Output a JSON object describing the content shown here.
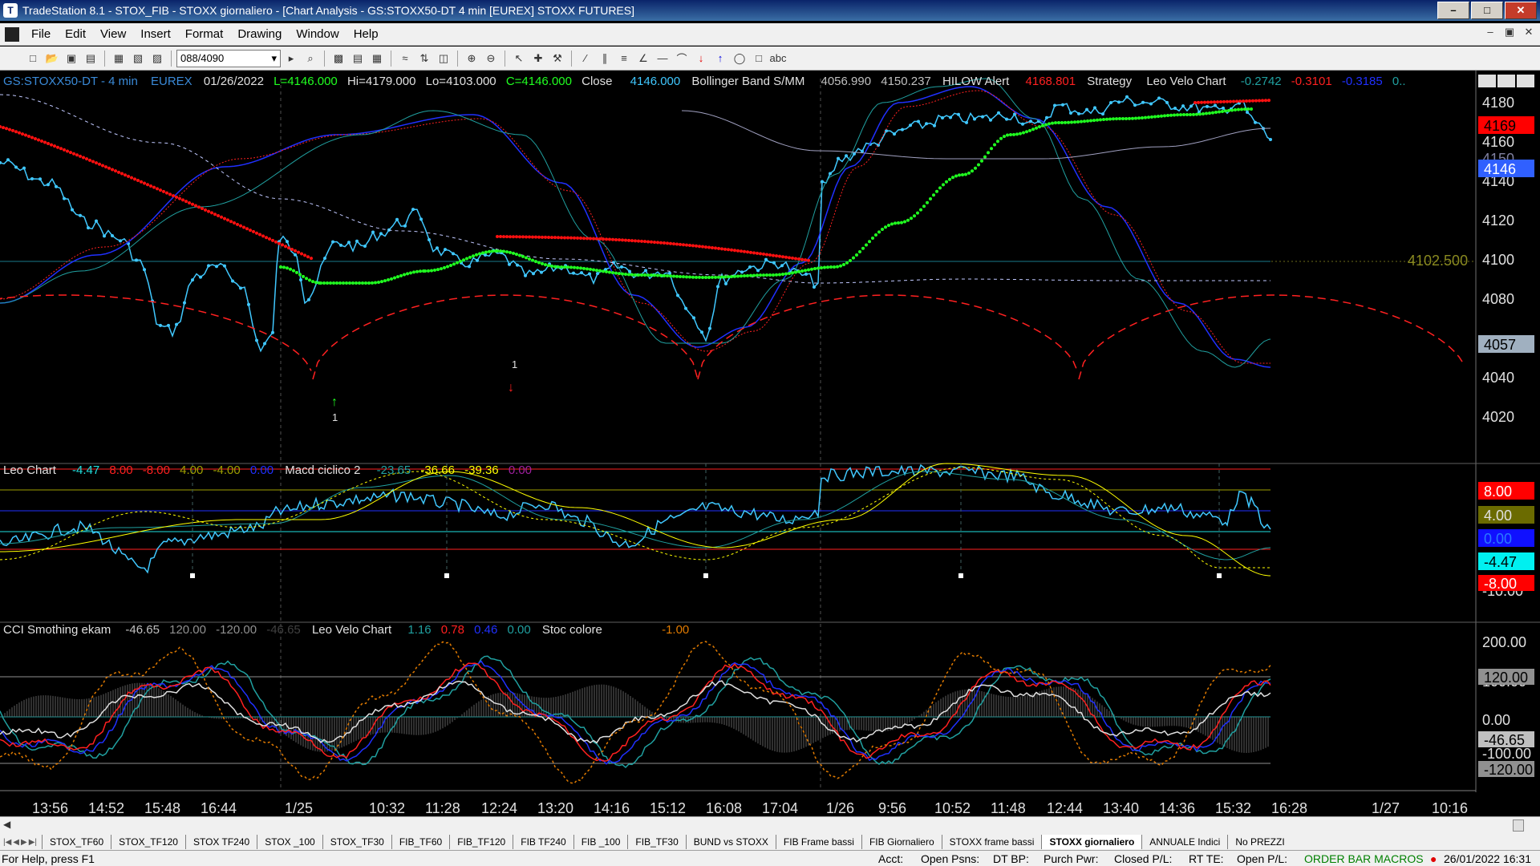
{
  "window": {
    "title": "TradeStation 8.1 - STOX_FIB - STOXX giornaliero - [Chart Analysis - GS:STOXX50-DT  4 min  [EUREX] STOXX FUTURES]",
    "min": "–",
    "max": "□",
    "close": "✕"
  },
  "menu": [
    "File",
    "Edit",
    "View",
    "Insert",
    "Format",
    "Drawing",
    "Window",
    "Help"
  ],
  "mdi": [
    "–",
    "▣",
    "✕"
  ],
  "toolbar": {
    "symbol_box": "088/4090"
  },
  "price_header": {
    "symbol": "GS:STOXX50-DT - 4 min",
    "exchange": "EUREX",
    "date": "01/26/2022",
    "last": "L=4146.000",
    "hi": "Hi=4179.000",
    "lo": "Lo=4103.000",
    "close_eq": "C=4146.000",
    "close_label": "Close",
    "close_val": "4146.000",
    "bb_label": "Bollinger Band S/MM",
    "bb_v1": "4056.990",
    "bb_v2": "4150.237",
    "hilow_label": "HILOW Alert",
    "hilow_val": "4168.801",
    "strategy": "Strategy",
    "lvc_label": "Leo Velo Chart",
    "lvc_v1": "-0.2742",
    "lvc_v2": "-0.3101",
    "lvc_v3": "-0.3185",
    "lvc_v4": "0.."
  },
  "pane2_header": {
    "leo": "Leo Chart",
    "v1": "-4.47",
    "v2": "8.00",
    "v3": "-8.00",
    "v4": "4.00",
    "v5": "-4.00",
    "v6": "0.00",
    "macd": "Macd ciclico 2",
    "m1": "-23.65",
    "m2": "-36.66",
    "m3": "-39.36",
    "m4": "0.00"
  },
  "pane3_header": {
    "cci": "CCI Smothing ekam",
    "c1": "-46.65",
    "c2": "120.00",
    "c3": "-120.00",
    "c4": "-46.65",
    "lvc": "Leo Velo Chart",
    "l1": "1.16",
    "l2": "0.78",
    "l3": "0.46",
    "l4": "0.00",
    "stoc": "Stoc colore",
    "s1": "-1.00"
  },
  "price_axis": {
    "ticks": [
      "4180",
      "4160",
      "4140",
      "4120",
      "4100",
      "4080",
      "4040",
      "4020"
    ],
    "tag_4169": "4169",
    "tag_4146": "4146",
    "tag_4057": "4057",
    "ref_line": "4102.500",
    "faint_4150": "4150"
  },
  "pane2_axis": {
    "t8": "8.00",
    "t4": "4.00",
    "t0": "0.00",
    "tm447": "-4.47",
    "tm8": "-8.00",
    "tm10": "-10.00"
  },
  "pane3_axis": {
    "t200": "200.00",
    "t120": "120.00",
    "t100": "100.00",
    "t0": "0.00",
    "tm4665": "-46.65",
    "tm100": "-100.00",
    "tm120": "-120.00"
  },
  "time_axis": [
    "13:56",
    "14:52",
    "15:48",
    "16:44",
    "1/25",
    "10:32",
    "11:28",
    "12:24",
    "13:20",
    "14:16",
    "15:12",
    "16:08",
    "17:04",
    "1/26",
    "9:56",
    "10:52",
    "11:48",
    "12:44",
    "13:40",
    "14:36",
    "15:32",
    "16:28",
    "1/27",
    "10:16"
  ],
  "markers": {
    "up1": "1",
    "dn1": "1"
  },
  "tabs": [
    "STOX_TF60",
    "STOX_TF120",
    "STOX TF240",
    "STOX _100",
    "STOX_TF30",
    "FIB_TF60",
    "FIB_TF120",
    "FIB TF240",
    "FIB _100",
    "FIB_TF30",
    "BUND vs STOXX",
    "FIB Frame bassi",
    "FIB Giornaliero",
    "STOXX frame bassi",
    "STOXX giornaliero",
    "ANNUALE Indici",
    "No PREZZI"
  ],
  "status": {
    "help": "For Help, press F1",
    "acct": "Acct:",
    "open_psns": "Open Psns:",
    "dt_bp": "DT BP:",
    "purch_pwr": "Purch Pwr:",
    "closed_pl": "Closed P/L:",
    "rt_te": "RT TE:",
    "open_pl": "Open P/L:",
    "macros": "ORDER BAR  MACROS",
    "datetime": "26/01/2022 16:31"
  },
  "colors": {
    "price_cyan": "#40c8ff",
    "bb_blue": "#2030ff",
    "bb_red": "#ff2020",
    "teal": "#20a0a0",
    "green_ma": "#20ff20",
    "red_ma": "#ff1010",
    "yellow": "#ffff00",
    "olive": "#a0a000"
  }
}
